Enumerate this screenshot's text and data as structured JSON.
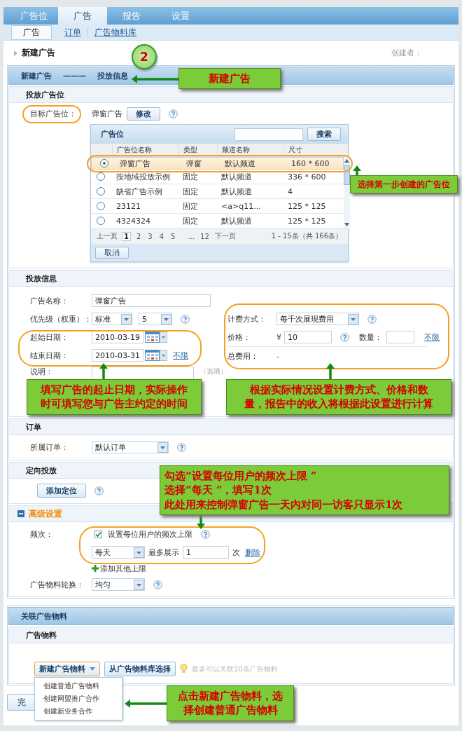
{
  "top_tabs": [
    {
      "label": "广告位",
      "selected": false
    },
    {
      "label": "广告",
      "selected": true
    },
    {
      "label": "报告",
      "selected": false
    },
    {
      "label": "设置",
      "selected": false
    }
  ],
  "sub_tabs": [
    {
      "label": "广告",
      "selected": true
    },
    {
      "label": "订单",
      "selected": false
    },
    {
      "label": "广告物料库",
      "selected": false
    }
  ],
  "page_title": "新建广告",
  "creator_label": "创建者：",
  "step_badge": "2",
  "breadcrumb": [
    "新建广告",
    "———",
    "投放信息"
  ],
  "placement": {
    "title": "投放广告位",
    "target_label": "目标广告位：",
    "target_value": "弹窗广告",
    "modify_button": "修改",
    "picker": {
      "title": "广告位",
      "search_button": "搜索",
      "columns": [
        "广告位名称",
        "类型",
        "频道名称",
        "尺寸"
      ],
      "rows": [
        {
          "selected": true,
          "cells": [
            "弹窗广告",
            "弹窗",
            "默认频道",
            "160 * 600"
          ]
        },
        {
          "selected": false,
          "cells": [
            "按地域投放示例",
            "固定",
            "默认频道",
            "336 * 600"
          ]
        },
        {
          "selected": false,
          "cells": [
            "缺省广告示例",
            "固定",
            "默认频道",
            "4"
          ]
        },
        {
          "selected": false,
          "cells": [
            "23121",
            "固定",
            "<a>q11...",
            "125 * 125"
          ]
        },
        {
          "selected": false,
          "cells": [
            "4324324",
            "固定",
            "默认频道",
            "125 * 125"
          ]
        }
      ],
      "pagination": {
        "prev": "上一页",
        "pages": [
          {
            "label": "1",
            "selected": true
          },
          {
            "label": "2",
            "selected": false
          },
          {
            "label": "3",
            "selected": false
          },
          {
            "label": "4",
            "selected": false
          },
          {
            "label": "5",
            "selected": false
          }
        ],
        "gap": "...",
        "last": "12",
        "next": "下一页",
        "summary": "1 - 15条（共 166条）"
      },
      "cancel_button": "取消"
    }
  },
  "delivery": {
    "title": "投放信息",
    "name": {
      "label": "广告名称：",
      "value": "弹窗广告"
    },
    "priority": {
      "label": "优先级（权重）：",
      "level_value": "标准",
      "weight_value": "5"
    },
    "start_date": {
      "label": "起始日期：",
      "value": "2010-03-19"
    },
    "end_date": {
      "label": "结束日期：",
      "value": "2010-03-31",
      "unlimited_link": "不限"
    },
    "note": {
      "label": "说明：",
      "hint": "（选填）"
    },
    "billing": {
      "label": "计费方式：",
      "value": "每千次展现费用"
    },
    "price": {
      "label": "价格：",
      "currency": "¥",
      "value": "10"
    },
    "quantity": {
      "label": "数量：",
      "unlimited_link": "不限"
    },
    "total": {
      "label": "总费用：",
      "value": "-"
    }
  },
  "order": {
    "title": "订单",
    "label": "所属订单：",
    "value": "默认订单"
  },
  "targeting": {
    "title": "定向投放",
    "add_button": "添加定位"
  },
  "advanced": {
    "title": "高级设置",
    "expanded": true,
    "frequency": {
      "label": "频次：",
      "checkbox_label": "设置每位用户的频次上限",
      "checked": true,
      "period": "每天",
      "max_label": "最多展示",
      "max_value": "1",
      "unit": "次",
      "delete_link": "删除",
      "add_link": "添加其他上限"
    },
    "rotation": {
      "label": "广告物料轮换：",
      "value": "均匀"
    }
  },
  "materials": {
    "panel_title": "关联广告物料",
    "title": "广告物料",
    "new_button": "新建广告物料",
    "library_button": "从广告物料库选择",
    "hint": "最多可以关联10条广告物料",
    "menu": [
      "创建普通广告物料",
      "创建网盟推广合作",
      "创建新业务合作"
    ]
  },
  "finish_button": "完",
  "callouts": [
    {
      "lines": [
        "新建广告"
      ]
    },
    {
      "lines": [
        "选择第一步创建的广告位"
      ]
    },
    {
      "lines": [
        "填写广告的起止日期，实际操作",
        "时可填写您与广告主约定的时间"
      ]
    },
    {
      "lines": [
        "根据实际情况设置计费方式、价格和数",
        "量，报告中的收入将根据此设置进行计算"
      ]
    },
    {
      "lines": [
        "勾选“设置每位用户的频次上限 ”",
        "选择“每天 ”，填写1次",
        "此处用来控制弹窗广告一天内对同一访客只显示1次"
      ]
    },
    {
      "lines": [
        "点击新建广告物料，选",
        "择创建普通广告物料"
      ]
    }
  ]
}
